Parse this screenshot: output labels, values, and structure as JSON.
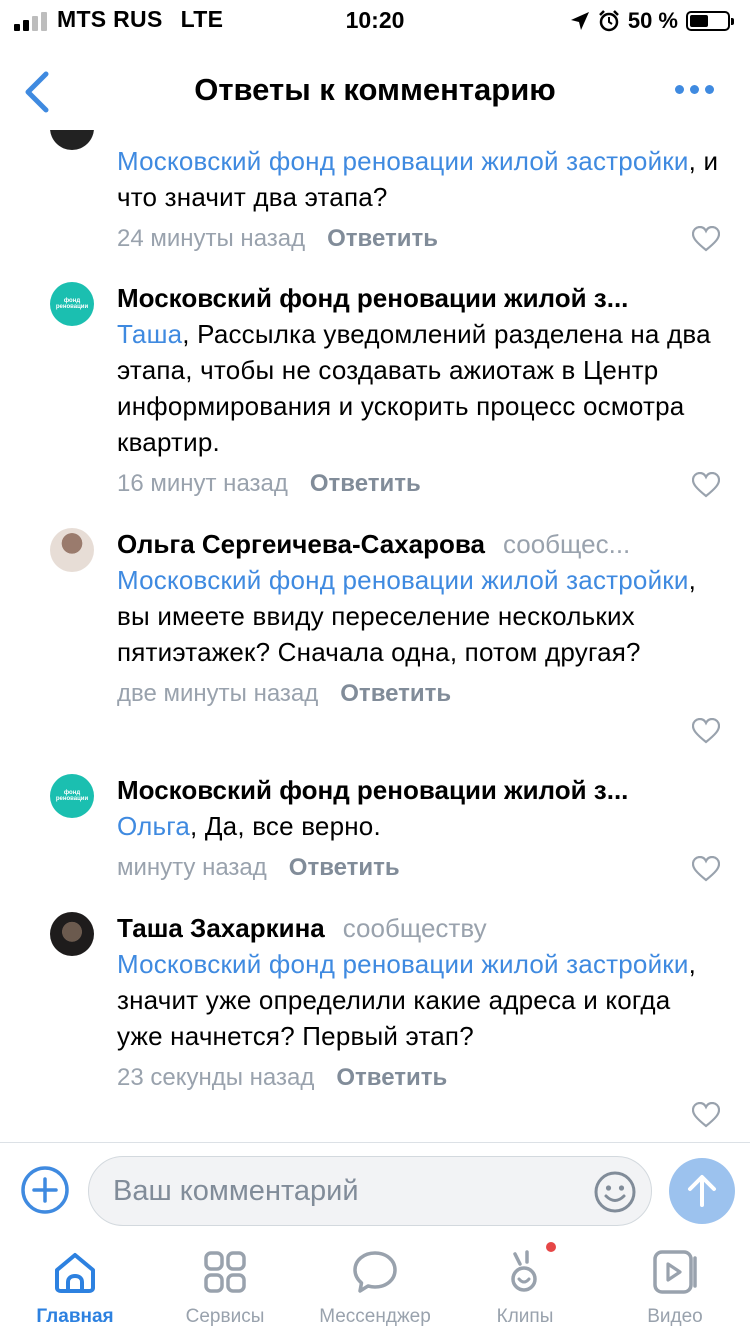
{
  "status": {
    "carrier": "MTS RUS",
    "network": "LTE",
    "time": "10:20",
    "battery": "50 %",
    "battery_fraction": 0.5
  },
  "header": {
    "title": "Ответы к комментарию"
  },
  "comments": [
    {
      "mention": "Московский фонд реновации жилой застройки",
      "text": ", и что значит два этапа?",
      "time": "24 минуты назад",
      "reply": "Ответить"
    },
    {
      "author": "Московский фонд реновации жилой з...",
      "mention": "Таша",
      "text": ", Рассылка уведомлений разделена на два этапа, чтобы не создавать ажиотаж в Центр информирования и ускорить процесс осмотра квартир.",
      "time": "16 минут назад",
      "reply": "Ответить"
    },
    {
      "author": "Ольга Сергеичева-Сахарова",
      "tag": "сообщес...",
      "mention": "Московский фонд реновации жилой застройки",
      "text": ", вы имеете ввиду переселение нескольких пятиэтажек? Сначала одна, потом другая?",
      "time": "две минуты назад",
      "reply": "Ответить"
    },
    {
      "author": "Московский фонд реновации жилой з...",
      "mention": "Ольга",
      "text": ", Да, все верно.",
      "time": "минуту назад",
      "reply": "Ответить"
    },
    {
      "author": "Таша Захаркина",
      "tag": "сообществу",
      "mention": "Московский фонд реновации жилой застройки",
      "text": ", значит уже определили какие адреса и когда уже начнется? Первый этап?",
      "time": "23 секунды назад",
      "reply": "Ответить"
    }
  ],
  "avatar_logo": {
    "line1": "фонд",
    "line2": "реновации"
  },
  "composer": {
    "placeholder": "Ваш комментарий"
  },
  "tabs": [
    {
      "label": "Главная",
      "icon": "home-icon"
    },
    {
      "label": "Сервисы",
      "icon": "services-icon"
    },
    {
      "label": "Мессенджер",
      "icon": "messenger-icon"
    },
    {
      "label": "Клипы",
      "icon": "clips-icon"
    },
    {
      "label": "Видео",
      "icon": "video-icon"
    }
  ],
  "colors": {
    "accent": "#3f8ae0",
    "meta": "#99a2ad",
    "send": "#9cc2ee",
    "fond": "#1bbfb0"
  }
}
